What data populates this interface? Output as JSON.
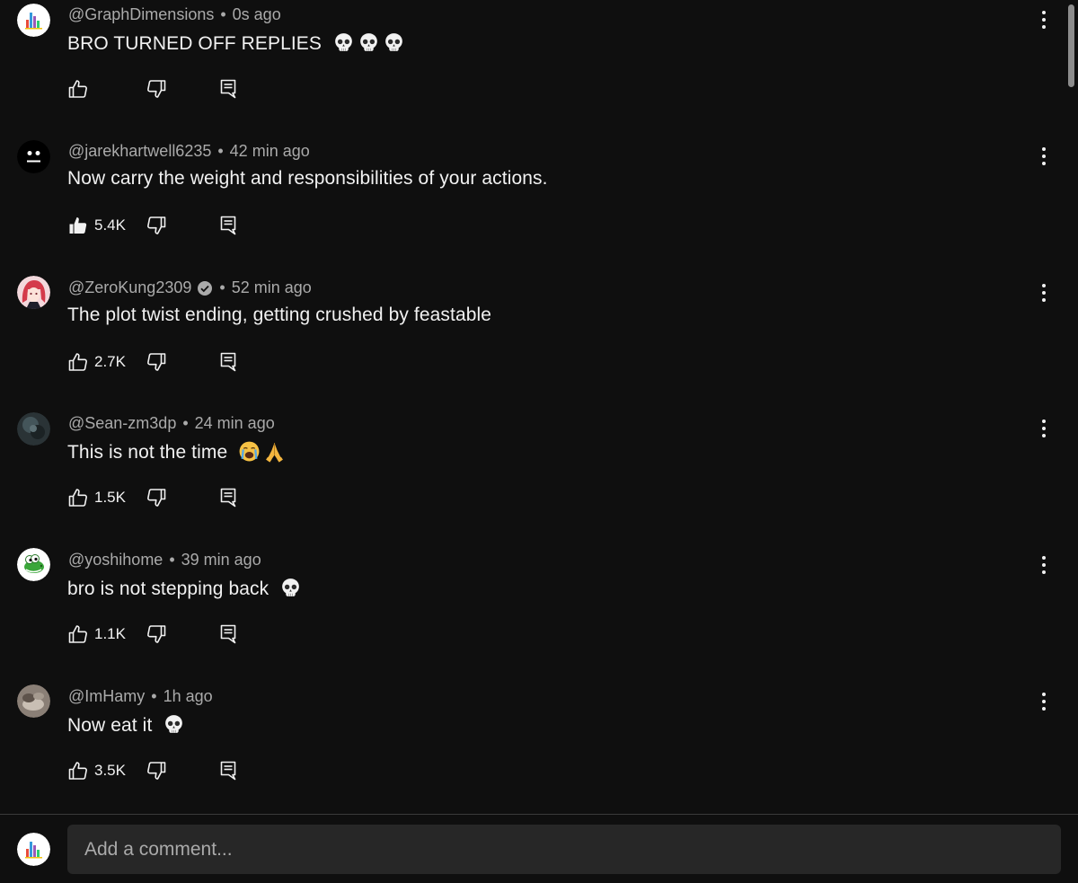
{
  "comments": [
    {
      "author": "@GraphDimensions",
      "time": "0s ago",
      "text": "BRO TURNED OFF REPLIES",
      "emojis": [
        "skull-icon",
        "skull-icon",
        "skull-icon"
      ],
      "likes": "",
      "liked": false,
      "verified": false,
      "avatar": "graph-avatar"
    },
    {
      "author": "@jarekhartwell6235",
      "time": "42 min ago",
      "text": "Now carry the weight and responsibilities of your actions.",
      "emojis": [],
      "likes": "5.4K",
      "liked": true,
      "verified": false,
      "avatar": "face-avatar"
    },
    {
      "author": "@ZeroKung2309",
      "time": "52 min ago",
      "text": "The plot twist ending, getting crushed by feastable",
      "emojis": [],
      "likes": "2.7K",
      "liked": false,
      "verified": true,
      "avatar": "anime-avatar"
    },
    {
      "author": "@Sean-zm3dp",
      "time": "24 min ago",
      "text": "This is not the time",
      "emojis": [
        "crying-face-icon",
        "folded-hands-icon"
      ],
      "likes": "1.5K",
      "liked": false,
      "verified": false,
      "avatar": "dark-avatar"
    },
    {
      "author": "@yoshihome",
      "time": "39 min ago",
      "text": "bro is not stepping back",
      "emojis": [
        "skull-icon"
      ],
      "likes": "1.1K",
      "liked": false,
      "verified": false,
      "avatar": "yoshi-avatar"
    },
    {
      "author": "@ImHamy",
      "time": "1h ago",
      "text": "Now eat it",
      "emojis": [
        "skull-icon"
      ],
      "likes": "3.5K",
      "liked": false,
      "verified": false,
      "avatar": "photo-avatar"
    }
  ],
  "composer": {
    "placeholder": "Add a comment...",
    "avatar": "graph-avatar"
  },
  "colors": {
    "background": "#0f0f0f",
    "text": "#f1f1f1",
    "secondary_text": "#aaaaaa",
    "input_background": "#272727"
  }
}
